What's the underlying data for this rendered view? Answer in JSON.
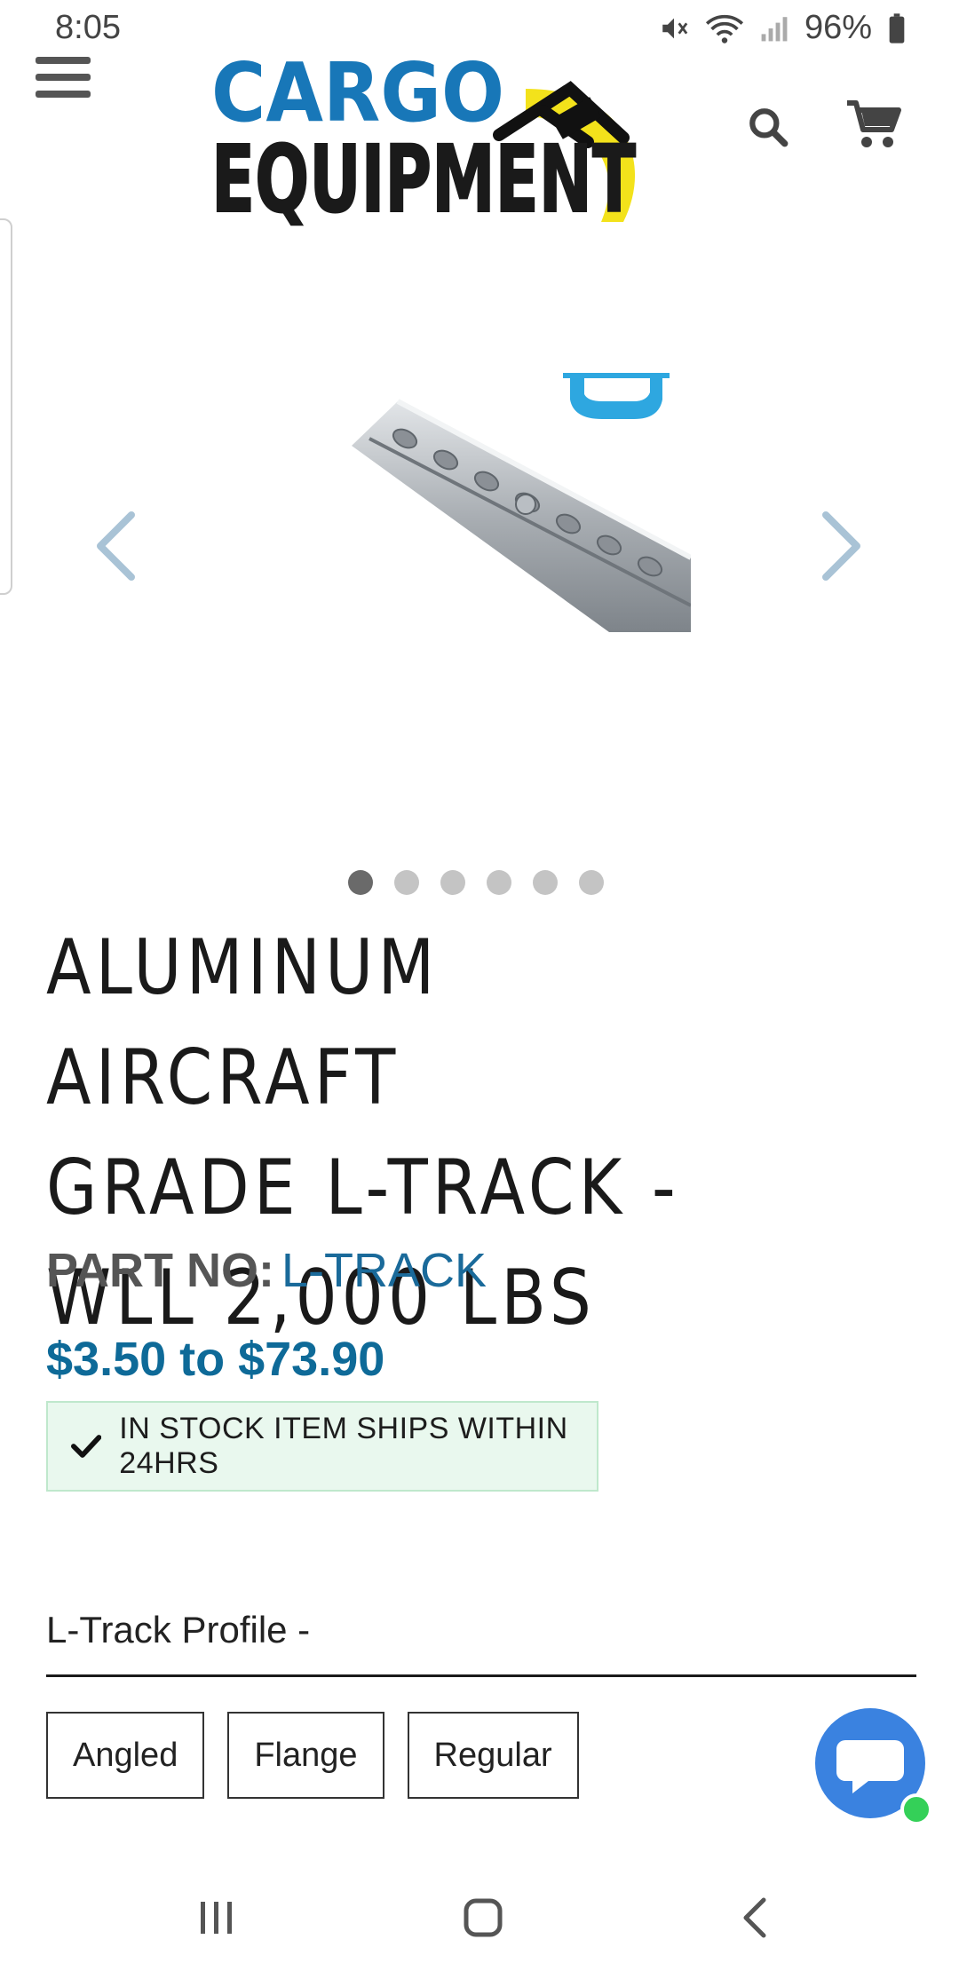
{
  "status_bar": {
    "time": "8:05",
    "battery_percent": "96%",
    "icons": [
      "mute-icon",
      "wifi-icon",
      "signal-icon",
      "battery-icon"
    ]
  },
  "header": {
    "logo_text_top": "CARGO",
    "logo_text_bottom": "EQUIPMENT",
    "icons": [
      "hamburger-menu-icon",
      "search-icon",
      "cart-icon"
    ]
  },
  "gallery": {
    "image_count": 6,
    "active_index": 0,
    "prev_icon": "chevron-left-icon",
    "next_icon": "chevron-right-icon"
  },
  "product": {
    "title_lines": [
      "ALUMINUM AIRCRAFT",
      "GRADE L-TRACK -",
      "WLL 2,000 LBS"
    ],
    "part_label": "PART NO:",
    "part_value": "L-TRACK",
    "price": "$3.50 to $73.90",
    "stock_text": "IN STOCK ITEM SHIPS WITHIN 24HRS"
  },
  "options": {
    "label": "L-Track Profile -",
    "items": [
      "Angled",
      "Flange",
      "Regular"
    ]
  },
  "colors": {
    "accent_blue": "#0e6a98",
    "stock_bg": "#e9f8ee",
    "chat_blue": "#3a82e0",
    "online_green": "#34d058"
  }
}
